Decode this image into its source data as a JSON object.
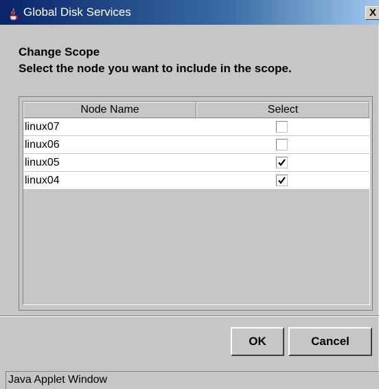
{
  "window": {
    "title": "Global Disk Services",
    "close_label": "X",
    "app_icon": "java-cup-icon"
  },
  "header": {
    "title": "Change Scope",
    "instruction": "Select the node you want to include in the scope."
  },
  "table": {
    "columns": [
      "Node Name",
      "Select"
    ],
    "rows": [
      {
        "name": "linux07",
        "selected": false
      },
      {
        "name": "linux06",
        "selected": false
      },
      {
        "name": "linux05",
        "selected": true
      },
      {
        "name": "linux04",
        "selected": true
      }
    ]
  },
  "buttons": {
    "ok_label": "OK",
    "cancel_label": "Cancel"
  },
  "status": {
    "text": "Java Applet Window"
  }
}
